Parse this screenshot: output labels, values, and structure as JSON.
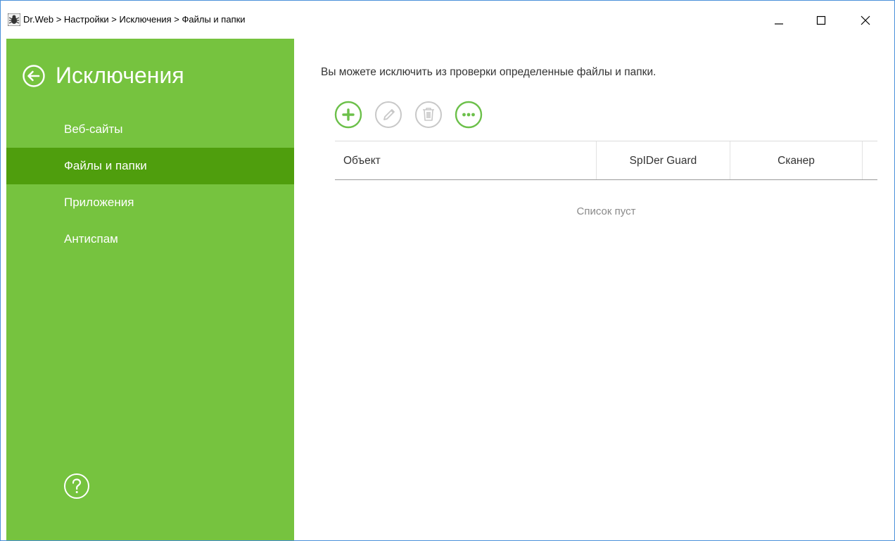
{
  "window": {
    "title": "Dr.Web > Настройки > Исключения > Файлы и папки",
    "controls": [
      "minimize",
      "maximize",
      "close"
    ]
  },
  "sidebar": {
    "title": "Исключения",
    "items": [
      {
        "label": "Веб-сайты",
        "active": false
      },
      {
        "label": "Файлы и папки",
        "active": true
      },
      {
        "label": "Приложения",
        "active": false
      },
      {
        "label": "Антиспам",
        "active": false
      }
    ],
    "help_icon": "help-icon",
    "back_icon": "back-arrow-icon"
  },
  "main": {
    "description": "Вы можете исключить из проверки определенные файлы и папки.",
    "toolbar": [
      {
        "icon": "add-icon",
        "enabled": true
      },
      {
        "icon": "edit-icon",
        "enabled": false
      },
      {
        "icon": "delete-icon",
        "enabled": false
      },
      {
        "icon": "more-icon",
        "enabled": true
      }
    ],
    "table": {
      "columns": [
        "Объект",
        "SpIDer Guard",
        "Сканер"
      ],
      "rows": [],
      "empty_text": "Список пуст"
    }
  },
  "colors": {
    "sidebar": "#76c33f",
    "sidebar_active": "#4f9e0d",
    "accent": "#6cc04a",
    "disabled": "#c8c8c8"
  }
}
